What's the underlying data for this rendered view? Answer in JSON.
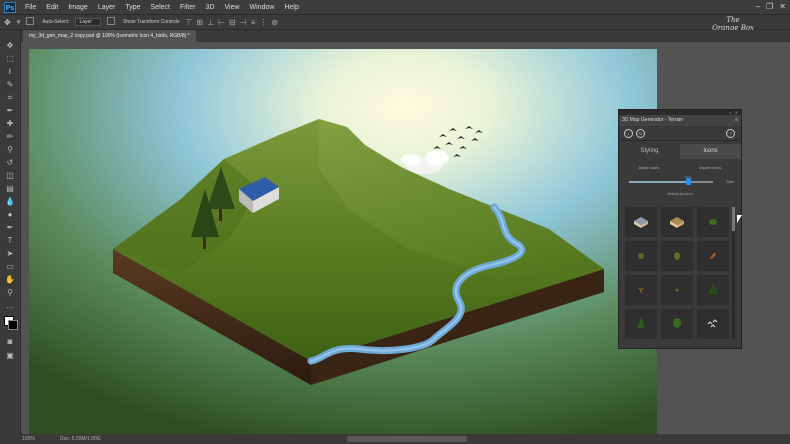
{
  "menu": [
    "File",
    "Edit",
    "Image",
    "Layer",
    "Type",
    "Select",
    "Filter",
    "3D",
    "View",
    "Window",
    "Help"
  ],
  "app_logo": "Ps",
  "options_bar": {
    "auto_select_label": "Auto-Select:",
    "auto_select_value": "Layer",
    "show_transform_label": "Show Transform Controls"
  },
  "brand": {
    "line1": "The",
    "line2": "Orange Box"
  },
  "document_tab": "my_3d_gen_map_2 copy.psd @ 100% (Isometric Icon 4_birds, RGB/8) *",
  "status": {
    "zoom": "100%",
    "doc": "Doc: 5.60M/1.80G"
  },
  "panel": {
    "title": "3D Map Generator - Terrain",
    "tabs": [
      "Styling",
      "Icons"
    ],
    "active_tab": "Icons",
    "subtabs": [
      "Basic Icons",
      "Import Icons"
    ],
    "slider_value": "70 %",
    "slider_fraction": 0.7,
    "size_label": "Size",
    "select_label": "Select an Icon",
    "icons": [
      "house-icon",
      "wood-hut-icon",
      "bush-icon",
      "shrub-icon",
      "shrub-tall-icon",
      "leaf-icon",
      "plant-small-icon",
      "sprout-icon",
      "pine-tree-icon",
      "tree-icon",
      "tree-round-icon",
      "birds-icon"
    ]
  },
  "colors": {
    "accent": "#2b8ef0",
    "ui_dark": "#3a3a3a",
    "ui_mid": "#535353"
  }
}
